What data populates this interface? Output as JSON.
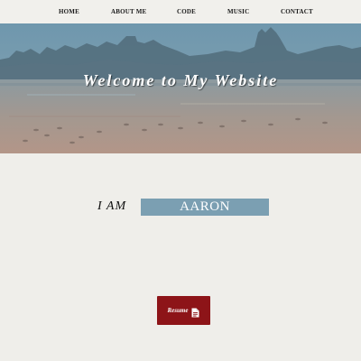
{
  "nav": {
    "items": [
      {
        "label": "HOME"
      },
      {
        "label": "ABOUT ME"
      },
      {
        "label": "CODE"
      },
      {
        "label": "MUSIC"
      },
      {
        "label": "CONTACT"
      }
    ]
  },
  "hero": {
    "title": "Welcome to My Website"
  },
  "intro": {
    "prefix": "I AM",
    "name": "AARON"
  },
  "resume": {
    "label": "Resume",
    "icon": "document-icon"
  },
  "colors": {
    "page_background": "#efeeea",
    "name_box": "#7b9fb2",
    "resume_button": "#8d1418"
  }
}
